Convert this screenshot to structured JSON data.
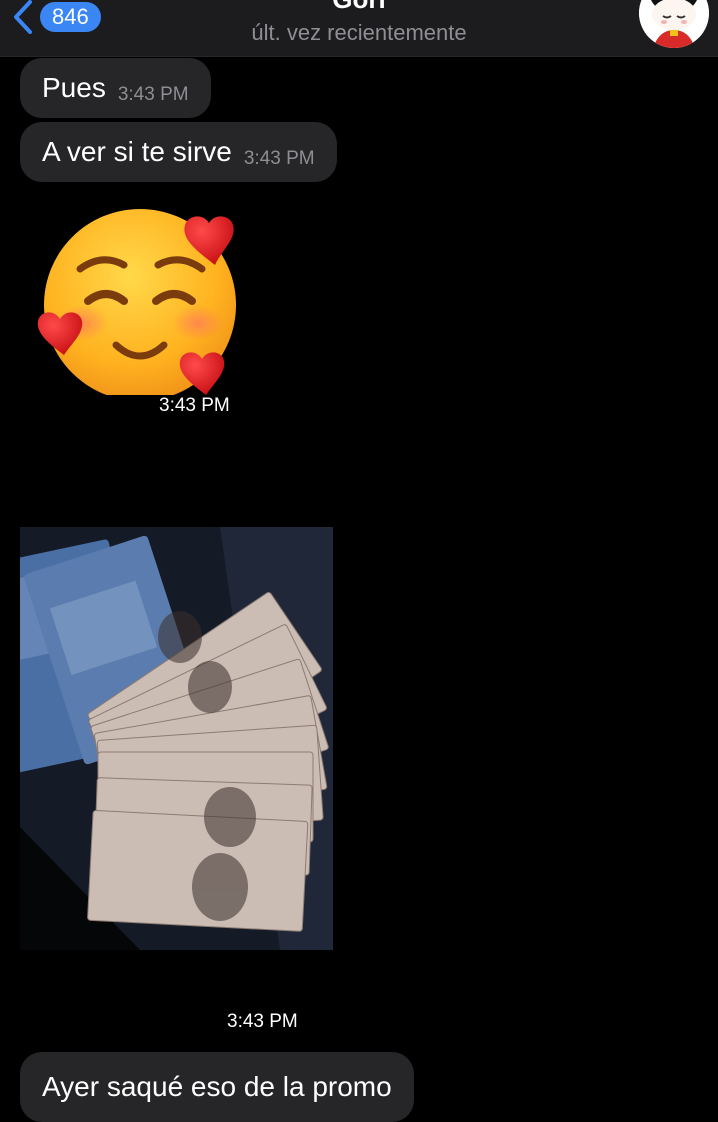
{
  "header": {
    "back_count": "846",
    "contact_name": "Gori",
    "status": "últ. vez recientemente"
  },
  "messages": [
    {
      "text": "Pues",
      "time": "3:43 PM"
    },
    {
      "text": "A ver si te sirve",
      "time": "3:43 PM"
    },
    {
      "sticker": "smiling-face-with-hearts",
      "time": "3:43 PM"
    },
    {
      "photo": "mexican-500-peso-banknotes",
      "time": "3:43 PM"
    },
    {
      "text": "Ayer saqué eso de la promo"
    }
  ],
  "colors": {
    "background": "#000000",
    "header_bg": "#1c1c1e",
    "bubble_bg": "#262628",
    "accent": "#3a86f5",
    "secondary_text": "#8e8e93"
  }
}
